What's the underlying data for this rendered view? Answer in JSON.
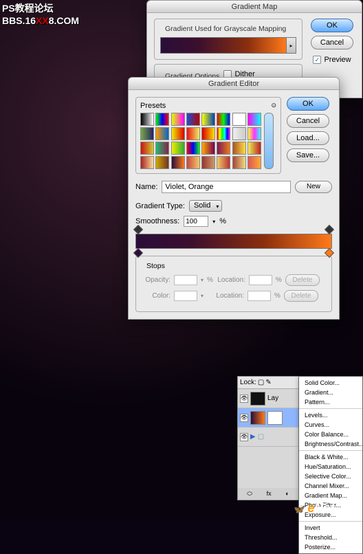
{
  "watermark": {
    "line1": "PS教程论坛",
    "line2_a": "BBS.16",
    "line2_b": "XX",
    "line2_c": "8.COM"
  },
  "gmap": {
    "title": "Gradient Map",
    "section1": "Gradient Used for Grayscale Mapping",
    "section2": "Gradient Options",
    "dither": "Dither",
    "ok": "OK",
    "cancel": "Cancel",
    "preview": "Preview"
  },
  "gedit": {
    "title": "Gradient Editor",
    "presets": "Presets",
    "ok": "OK",
    "cancel": "Cancel",
    "load": "Load...",
    "save": "Save...",
    "name_label": "Name:",
    "name_value": "Violet, Orange",
    "new_btn": "New",
    "type_label": "Gradient Type:",
    "type_value": "Solid",
    "smooth_label": "Smoothness:",
    "smooth_value": "100",
    "stops": "Stops",
    "opacity": "Opacity:",
    "color": "Color:",
    "location": "Location:",
    "delete": "Delete",
    "percent": "%"
  },
  "swatches": [
    "linear-gradient(90deg,#000,#fff)",
    "linear-gradient(90deg,#0f0,#00f,#f00)",
    "linear-gradient(90deg,#e0ff00,#f0f)",
    "linear-gradient(90deg,#1a4fd4,#b90000)",
    "linear-gradient(90deg,#ff0,#0041b8)",
    "linear-gradient(90deg,#f00,#0f0,#00f)",
    "linear-gradient(90deg,#fff,#fff)",
    "linear-gradient(90deg,#f0f,#0ff)",
    "linear-gradient(90deg,#7a4,#226)",
    "linear-gradient(90deg,#f90,#06c)",
    "linear-gradient(90deg,#ee0,#d00)",
    "linear-gradient(90deg,#e11,#ee6)",
    "linear-gradient(90deg,#d60000,#ffe000)",
    "linear-gradient(90deg,#f00,#ff0,#0f0,#0ff,#00f,#f0f)",
    "linear-gradient(90deg,#eee,#ccc)",
    "linear-gradient(90deg,#ff3,#f3f,#3ff)",
    "linear-gradient(90deg,#c11,#cc3)",
    "linear-gradient(90deg,#2b7,#824)",
    "linear-gradient(90deg,#ee0,#3a3)",
    "linear-gradient(90deg,#f00,#00f,#0f0)",
    "linear-gradient(90deg,#fa0,#705)",
    "linear-gradient(90deg,#7a1a55,#eb7a1a)",
    "linear-gradient(90deg,#a52,#fd4)",
    "linear-gradient(90deg,#ee5,#b22)",
    "linear-gradient(90deg,#a22,#fd9)",
    "linear-gradient(90deg,#ca0,#732)",
    "linear-gradient(90deg,#2a0d3a,#ff7a1a)",
    "linear-gradient(90deg,#c44,#ec6)",
    "linear-gradient(90deg,#933,#c96)",
    "linear-gradient(90deg,#ec6,#b33)",
    "linear-gradient(90deg,#a43,#ed8)",
    "linear-gradient(90deg,#d55,#fa3)"
  ],
  "layers": {
    "lock": "Lock:",
    "lay": "Lay"
  },
  "adjmenu": {
    "g1": [
      "Solid Color...",
      "Gradient...",
      "Pattern..."
    ],
    "g2": [
      "Levels...",
      "Curves...",
      "Color Balance...",
      "Brightness/Contrast..."
    ],
    "g3": [
      "Black & White...",
      "Hue/Saturation...",
      "Selective Color...",
      "Channel Mixer...",
      "Gradient Map...",
      "Photo Filter...",
      "Exposure..."
    ],
    "g4": [
      "Invert",
      "Threshold...",
      "Posterize..."
    ]
  },
  "enet": {
    "e": "e",
    "net": "Net",
    "dom": ".com.cn"
  }
}
